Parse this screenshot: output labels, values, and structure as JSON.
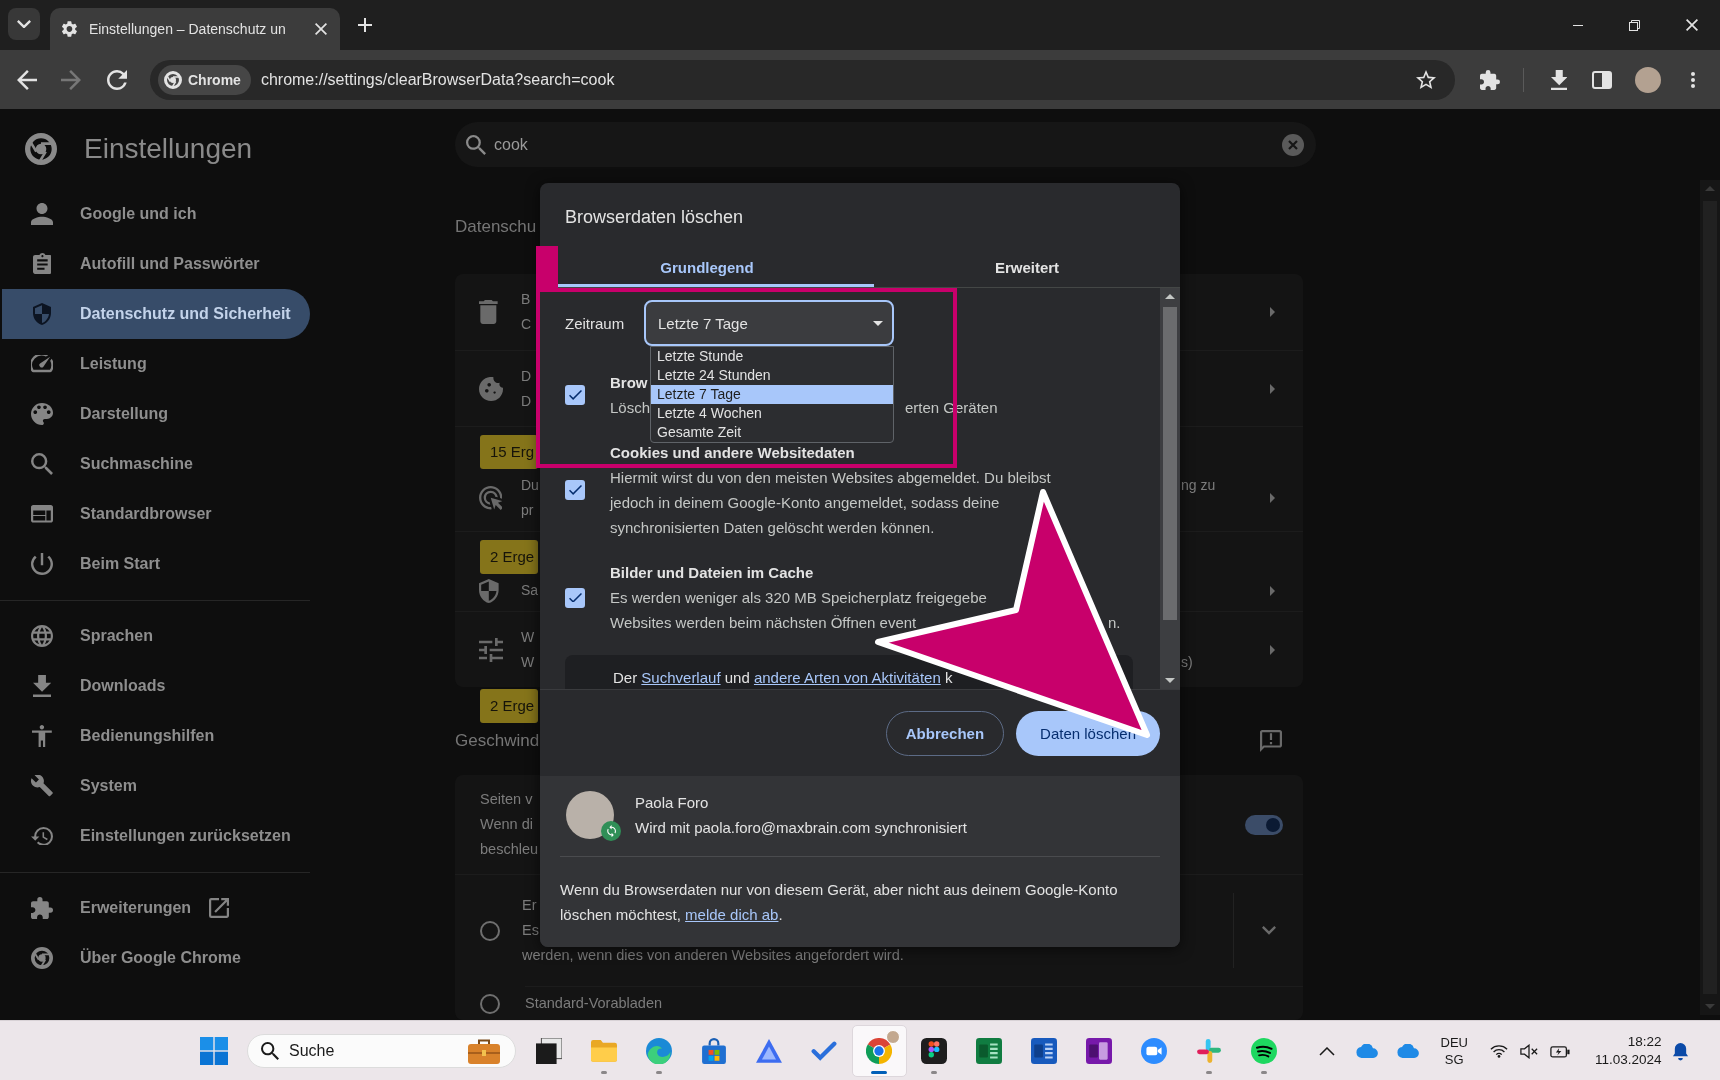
{
  "browser": {
    "tab": {
      "title": "Einstellungen – Datenschutz un"
    },
    "navigation": [
      {
        "kind": "back",
        "disabled": false
      },
      {
        "kind": "forward",
        "disabled": true
      },
      {
        "kind": "reload",
        "disabled": false
      }
    ],
    "address": {
      "chip": "Chrome",
      "url": "chrome://settings/clearBrowserData?search=cook"
    }
  },
  "sidebar": {
    "title": "Einstellungen",
    "groups": [
      {
        "items": [
          {
            "label": "Google und ich",
            "selected": false,
            "external": false
          },
          {
            "label": "Autofill und Passwörter",
            "selected": false,
            "external": false
          },
          {
            "label": "Datenschutz und Sicherheit",
            "selected": true,
            "external": false
          },
          {
            "label": "Leistung",
            "selected": false,
            "external": false
          },
          {
            "label": "Darstellung",
            "selected": false,
            "external": false
          },
          {
            "label": "Suchmaschine",
            "selected": false,
            "external": false
          },
          {
            "label": "Standardbrowser",
            "selected": false,
            "external": false
          },
          {
            "label": "Beim Start",
            "selected": false,
            "external": false
          }
        ]
      },
      {
        "items": [
          {
            "label": "Sprachen",
            "selected": false,
            "external": false
          },
          {
            "label": "Downloads",
            "selected": false,
            "external": false
          },
          {
            "label": "Bedienungshilfen",
            "selected": false,
            "external": false
          },
          {
            "label": "System",
            "selected": false,
            "external": false
          },
          {
            "label": "Einstellungen zurücksetzen",
            "selected": false,
            "external": false
          }
        ]
      },
      {
        "items": [
          {
            "label": "Erweiterungen",
            "selected": false,
            "external": true
          },
          {
            "label": "Über Google Chrome",
            "selected": false,
            "external": false
          }
        ]
      }
    ]
  },
  "settings": {
    "search": {
      "value": "cook"
    },
    "privacy": {
      "heading": "Datenschu",
      "rows": [
        {
          "lines": [
            {
              "text": "B"
            },
            {
              "text": "C"
            }
          ]
        },
        {
          "lines": [
            {
              "text": "D"
            },
            {
              "text": "D"
            }
          ]
        },
        {
          "badge": "15 Erg",
          "lines": [
            {
              "text": "Du",
              "tail": "ng zu"
            },
            {
              "text": "pr"
            }
          ]
        },
        {
          "badge": "2 Erge",
          "lines": [
            {
              "text": "Sa"
            }
          ]
        },
        {
          "lines": [
            {
              "text": "W"
            },
            {
              "text": "W",
              "tail": "s)"
            }
          ]
        }
      ]
    },
    "speed": {
      "badge": "2 Erge",
      "heading": "Geschwind",
      "rows": [
        {
          "kind": "toggle",
          "lines": [
            "Seiten v",
            "Wenn di",
            "beschleu"
          ],
          "on": true
        },
        {
          "kind": "radio",
          "lines": [
            "Er",
            "Es",
            "werden, wenn dies von anderen Websites angefordert wird."
          ],
          "selected": false,
          "expanded": false
        },
        {
          "kind": "radio",
          "lines": [
            "Standard-Vorabladen"
          ],
          "selected": false
        }
      ]
    }
  },
  "dialog": {
    "title": "Browserdaten löschen",
    "tabs": [
      {
        "label": "Grundlegend",
        "selected": true
      },
      {
        "label": "Erweitert",
        "selected": false
      }
    ],
    "time_range": {
      "label": "Zeitraum",
      "value": "Letzte 7 Tage",
      "expanded": true,
      "options": [
        {
          "label": "Letzte Stunde",
          "selected": false
        },
        {
          "label": "Letzte 24 Stunden",
          "selected": false
        },
        {
          "label": "Letzte 7 Tage",
          "selected": true
        },
        {
          "label": "Letzte 4 Wochen",
          "selected": false
        },
        {
          "label": "Gesamte Zeit",
          "selected": false
        }
      ]
    },
    "items": [
      {
        "title": "Brow",
        "description": [
          "Lösch"
        ],
        "tail": "erten Geräten",
        "checked": true
      },
      {
        "title": "Cookies und andere Websitedaten",
        "description": [
          "Hiermit wirst du von den meisten Websites abgemeldet. Du bleibst",
          "jedoch in deinem Google-Konto angemeldet, sodass deine",
          "synchronisierten Daten gelöscht werden können."
        ],
        "checked": true
      },
      {
        "title": "Bilder und Dateien im Cache",
        "description": [
          "Es werden weniger als 320 MB Speicherplatz freigegebe",
          "Websites werden beim nächsten Öffnen event"
        ],
        "tail": "n.",
        "checked": true
      }
    ],
    "info": [
      {
        "kind": "text",
        "text": "Der "
      },
      {
        "kind": "link",
        "text": "Suchverlauf"
      },
      {
        "kind": "text",
        "text": " und "
      },
      {
        "kind": "link",
        "text": "andere Arten von Aktivitäten"
      },
      {
        "kind": "text",
        "text": " k"
      }
    ],
    "buttons": [
      {
        "label": "Abbrechen",
        "kind": "outlined"
      },
      {
        "label": "Daten löschen",
        "kind": "filled"
      }
    ],
    "account": {
      "name": "Paola Foro",
      "status": "Wird mit paola.foro@maxbrain.com synchronisiert",
      "synced": true
    },
    "note": [
      {
        "kind": "text",
        "text": "Wenn du Browserdaten nur von diesem Gerät, aber nicht aus deinem Google-Konto löschen möchtest, "
      },
      {
        "kind": "link",
        "text": "melde dich ab"
      },
      {
        "kind": "text",
        "text": "."
      }
    ]
  },
  "taskbar": {
    "search": {
      "placeholder": "Suche"
    },
    "apps": [
      {
        "running": false,
        "selected": false
      },
      {
        "running": true,
        "selected": false
      },
      {
        "running": true,
        "selected": false
      },
      {
        "running": false,
        "selected": false
      },
      {
        "running": false,
        "selected": false
      },
      {
        "running": false,
        "selected": false
      },
      {
        "running": true,
        "selected": true
      },
      {
        "running": true,
        "selected": false
      },
      {
        "running": false,
        "selected": false
      },
      {
        "running": false,
        "selected": false
      },
      {
        "running": false,
        "selected": false
      },
      {
        "running": false,
        "selected": false
      },
      {
        "running": true,
        "selected": false
      },
      {
        "running": true,
        "selected": false
      }
    ],
    "language": {
      "code": "DEU",
      "layout": "SG"
    },
    "clock": {
      "time": "18:22",
      "date": "11.03.2024"
    }
  }
}
